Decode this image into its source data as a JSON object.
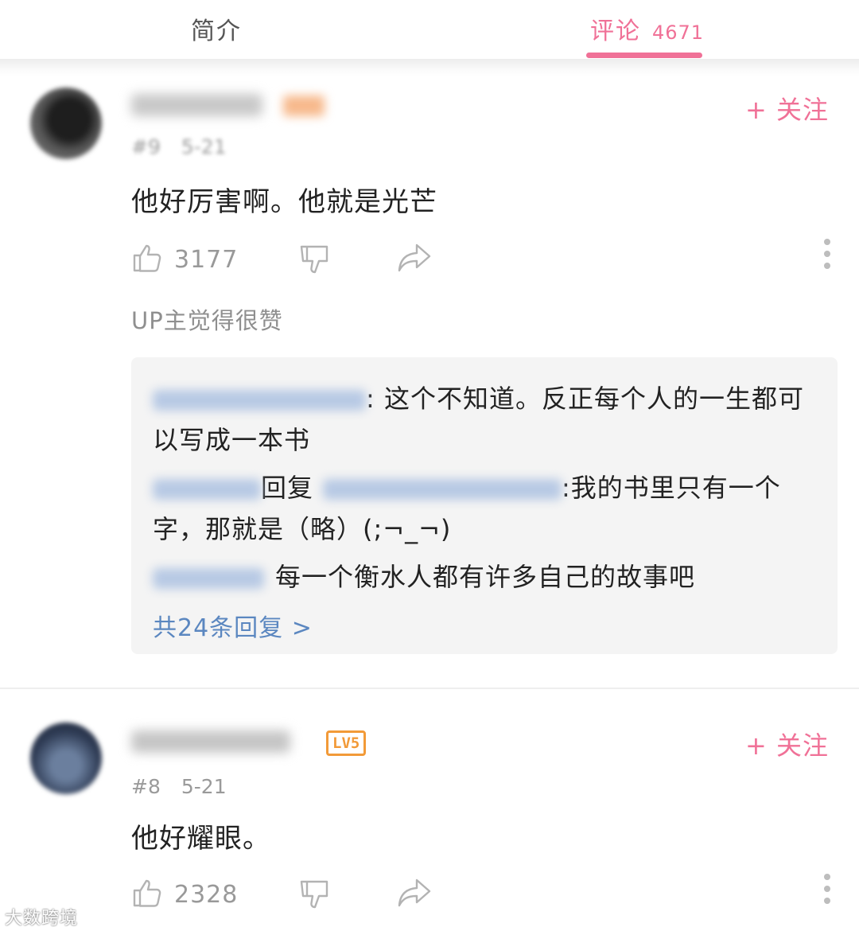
{
  "tabs": {
    "intro_label": "简介",
    "comments_label": "评论",
    "comments_count": "4671"
  },
  "comments": [
    {
      "follow_label": "+ 关注",
      "floor": "#9",
      "date": "5-21",
      "text": "他好厉害啊。他就是光芒",
      "like_count": "3177",
      "up_liked": "UP主觉得很赞",
      "replies": [
        {
          "text": ": 这个不知道。反正每个人的一生都可以写成一本书"
        },
        {
          "reply_word": "回复",
          "text": ":我的书里只有一个字，那就是（略）(;¬_¬)"
        },
        {
          "text": "每一个衡水人都有许多自己的故事吧"
        }
      ],
      "more_replies": "共24条回复 >"
    },
    {
      "follow_label": "+ 关注",
      "level": "LV5",
      "floor": "#8",
      "date": "5-21",
      "text": "他好耀眼。",
      "like_count": "2328"
    }
  ],
  "icons": {
    "like": "thumbs-up-icon",
    "dislike": "thumbs-down-icon",
    "share": "share-arrow-icon",
    "more": "vertical-dots-icon"
  },
  "colors": {
    "accent": "#f07197",
    "link": "#5b87c0",
    "level_badge": "#f29a38"
  },
  "watermark": "大数跨境"
}
